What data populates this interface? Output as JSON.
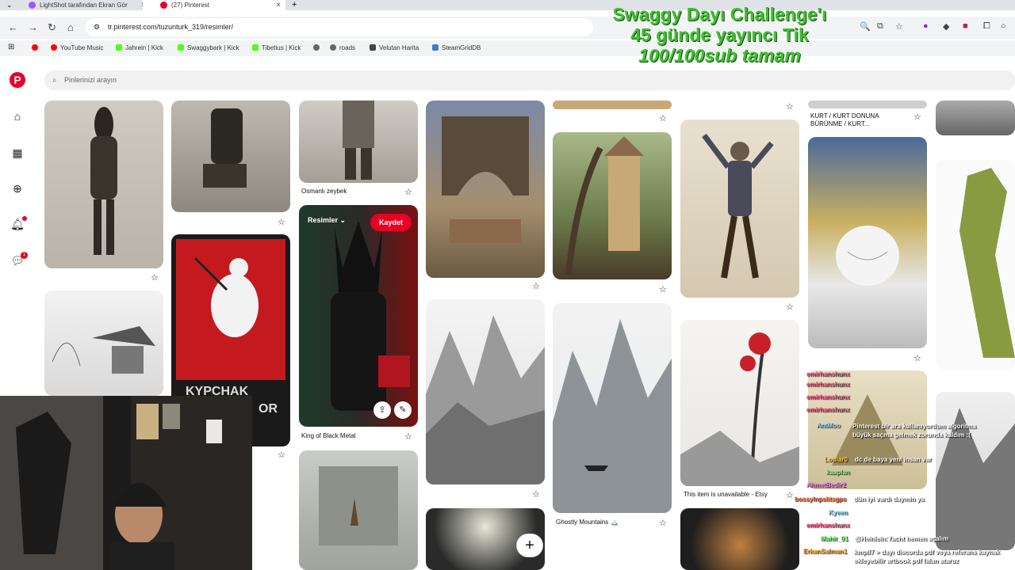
{
  "browser": {
    "tabs": [
      {
        "label": "LightShot tarafından Ekran Gör",
        "close": "×"
      },
      {
        "label": "(27) Pinterest",
        "close": "×"
      }
    ],
    "new_tab": "+",
    "url": "tr.pinterest.com/tuzunturk_319/resimler/",
    "bookmarks": [
      {
        "label": "YouTube Music",
        "color": "#ff0000"
      },
      {
        "label": "Jahrein | Kick",
        "color": "#53fc18"
      },
      {
        "label": "Swaggybark | Kick",
        "color": "#53fc18"
      },
      {
        "label": "Tibetius | Kick",
        "color": "#53fc18"
      },
      {
        "label": "roads",
        "color": "#666666"
      },
      {
        "label": "Velutan Harita",
        "color": "#444444"
      },
      {
        "label": "SteamGridDB",
        "color": "#3a7bd5"
      }
    ]
  },
  "stream_overlay": {
    "line1": "Swaggy Dayı Challenge'ı",
    "line2": "45 günde yayıncı Tik",
    "line3": "100/100sub tamam"
  },
  "sidebar": {
    "logo": "P",
    "icons": [
      "home-icon",
      "boards-icon",
      "create-icon",
      "notifications-icon",
      "messages-icon"
    ],
    "messages_badge": "1"
  },
  "search": {
    "placeholder": "Pinlerinizi arayın"
  },
  "pins": {
    "captions": {
      "zeybek": "Osmanlı zeybek",
      "black_metal": "King of Black Metal",
      "kurt": "KURT / KURT DONUNA BÜRÜNME / KURT...",
      "etsy": "This item is unavailable - Etsy",
      "ghostly": "Ghostly Mountains 🏔️"
    },
    "board_label": "Resimler ⌄",
    "save_label": "Kaydet",
    "poster_text": "KYPCHAK",
    "poster_text2": "OR"
  },
  "chat": [
    {
      "user": "emirhanshunx",
      "msg": "",
      "color": "#ff5a8a"
    },
    {
      "user": "emirhanshunx",
      "msg": "",
      "color": "#ff5a8a"
    },
    {
      "user": "emirhanshunx",
      "msg": "",
      "color": "#ff5a8a"
    },
    {
      "user": "emirhanshunx",
      "msg": "",
      "color": "#ff5a8a"
    },
    {
      "user": "AntMoo",
      "msg": "Pinterest bir ara kullanıyordum algoritma büyük saçma gelmek zorunda kaldım :(",
      "color": "#9fd7ff"
    },
    {
      "user": "Louiar0",
      "msg": "dc de baya yeni insan var",
      "color": "#ffcc44"
    },
    {
      "user": "kaaplan",
      "msg": "",
      "color": "#8aff8a"
    },
    {
      "user": "AhmetBedir2",
      "msg": "",
      "color": "#ff88ff"
    },
    {
      "user": "bossylnpsktsgps",
      "msg": "dün iyi vardı daymin ya",
      "color": "#ff7744"
    },
    {
      "user": "Kyeen",
      "msg": "",
      "color": "#88ddff"
    },
    {
      "user": "emirhanshunx",
      "msg": "",
      "color": "#ff5a8a"
    },
    {
      "user": "Mahir_01",
      "msg": "@Heinlein:Yacht hemen açalım",
      "color": "#7cff7c"
    },
    {
      "user": "ErkanSalman1",
      "msg": "kmpll7 > dayı discorda pdf veya referans kaynak ekleyebilir artbook pdf falan ataruz",
      "color": "#ffaa33"
    }
  ],
  "fab": "+"
}
